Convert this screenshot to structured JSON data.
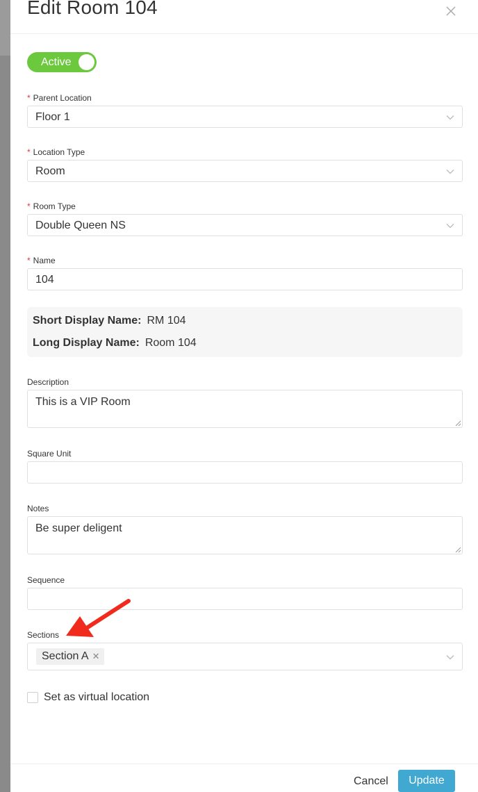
{
  "header": {
    "title": "Edit Room 104",
    "close_icon": "close-icon"
  },
  "status_toggle": {
    "label": "Active",
    "on": true,
    "color": "#6cc83d"
  },
  "fields": {
    "parent_location": {
      "label": "Parent Location",
      "required": "*",
      "value": "Floor 1"
    },
    "location_type": {
      "label": "Location Type",
      "required": "*",
      "value": "Room"
    },
    "room_type": {
      "label": "Room Type",
      "required": "*",
      "value": "Double Queen NS"
    },
    "name": {
      "label": "Name",
      "required": "*",
      "value": "104"
    },
    "description": {
      "label": "Description",
      "value": "This is a VIP Room"
    },
    "square_unit": {
      "label": "Square Unit",
      "value": ""
    },
    "notes": {
      "label": "Notes",
      "value": "Be super deligent"
    },
    "sequence": {
      "label": "Sequence",
      "value": ""
    },
    "sections": {
      "label": "Sections",
      "tags": [
        "Section A"
      ]
    }
  },
  "display_names": {
    "short_label": "Short Display Name:",
    "short_value": "RM 104",
    "long_label": "Long Display Name:",
    "long_value": "Room 104"
  },
  "virtual_location": {
    "label": "Set as virtual location",
    "checked": false
  },
  "footer": {
    "cancel_label": "Cancel",
    "update_label": "Update",
    "update_color": "#41a9d1"
  },
  "annotation": {
    "arrow_color": "#f02b1d"
  }
}
